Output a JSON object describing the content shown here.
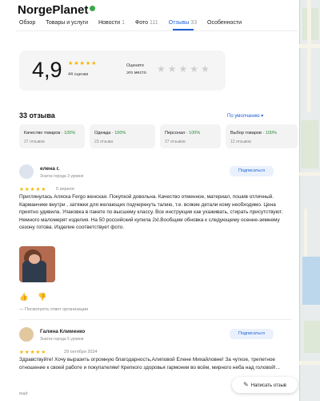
{
  "header": {
    "title": "NorgePlanet"
  },
  "tabs": [
    {
      "label": "Обзор",
      "count": ""
    },
    {
      "label": "Товары и услуги",
      "count": ""
    },
    {
      "label": "Новости",
      "count": "1"
    },
    {
      "label": "Фото",
      "count": "111"
    },
    {
      "label": "Отзывы",
      "count": "33"
    },
    {
      "label": "Особенности",
      "count": ""
    }
  ],
  "summary": {
    "rating": "4,9",
    "stars": "★★★★★",
    "rating_count": "44 оценки",
    "rate_prompt_line1": "Оцените",
    "rate_prompt_line2": "это место",
    "rate_stars": "★★★★★"
  },
  "reviews_header": {
    "count_label": "33 отзыва",
    "sort_label": "По умолчанию ▾"
  },
  "aspects": [
    {
      "label": "Качество товаров",
      "pct": "100%",
      "count": "27 отзывов"
    },
    {
      "label": "Одежда",
      "pct": "100%",
      "count": "23 отзыва"
    },
    {
      "label": "Персонал",
      "pct": "100%",
      "count": "27 отзывов"
    },
    {
      "label": "Выбор товаров",
      "pct": "100%",
      "count": "12 отзывов"
    }
  ],
  "reviews": [
    {
      "name": "елена г.",
      "badge": "Знаток города 3 уровня",
      "subscribe": "Подписаться",
      "stars": "★★★★★",
      "date": "5 апреля",
      "text": "Приглянулась Аляска Fergo женская. Покупкой довольна. Качество отменное, материал, пошив отличный. Карманчики внутри , затяжки для желающих подчеркнуть талию, т.е. всякие детали кому необходимо. Цена приятно удивила. Упаковка в пакете по высшему классу. Все инструкции как ухаживать, стирать присутствуют. Немного маломерят изделия. На 50 российский купила 2xl.Вообщем обновка к следующему осенне-зимнему сезону готова. Изделие соответствует фото.",
      "owner_response": "— Посмотреть ответ организации"
    },
    {
      "name": "Галина Клименко",
      "badge": "Знаток города 5 уровня",
      "subscribe": "Подписаться",
      "stars": "★★★★★",
      "date": "29 октября 2024",
      "text": "Здравствуйте! Хочу выразить огромную благодарность,Алиповой Елене Михайловне! За чуткое, трепетное отношение к своей работе и покупателям! Крепкого здоровья гармонии во всём, мирного неба над головой!...",
      "more": "ещё"
    }
  ],
  "actions": {
    "write_review": "Написать отзыв"
  },
  "colors": {
    "accent": "#1e62d6",
    "star": "#f4b400",
    "positive": "#2a8a38"
  }
}
